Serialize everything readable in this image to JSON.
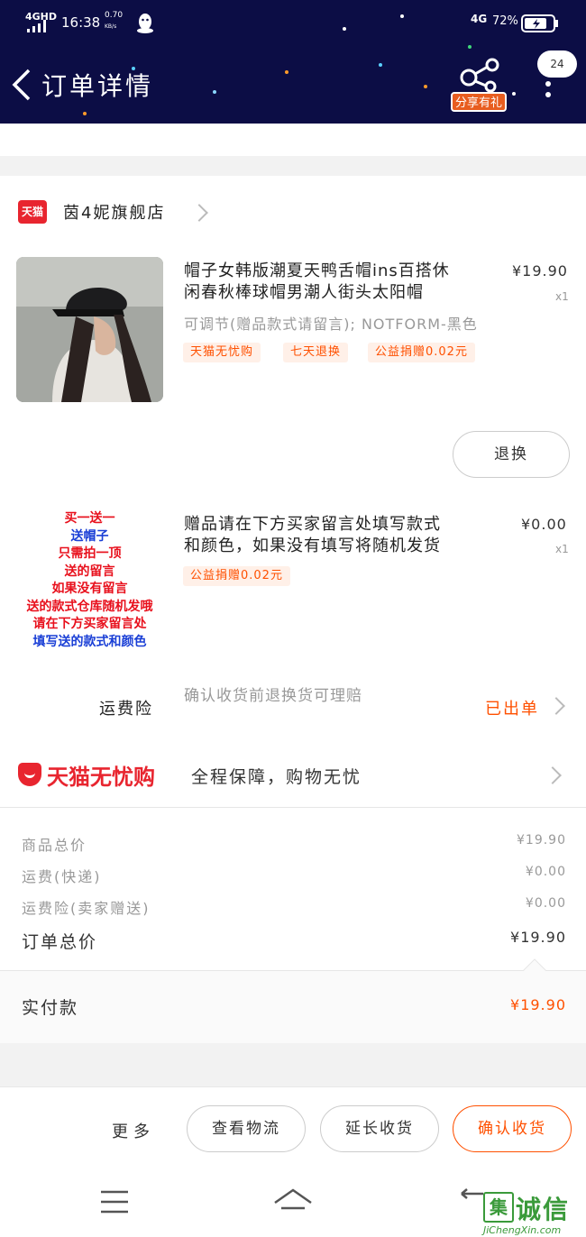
{
  "status_bar": {
    "network": "4GHD",
    "time": "16:38",
    "speed_value": "0.70",
    "speed_unit": "KB/s",
    "network_right": "4G",
    "battery": "72%"
  },
  "header": {
    "title": "订单详情",
    "share_label": "分享有礼",
    "message_count": "24"
  },
  "store": {
    "badge": "天猫",
    "name": "茵4妮旗舰店"
  },
  "items": [
    {
      "title_line1": "帽子女韩版潮夏天鸭舌帽ins百搭休",
      "title_line2": "闲春秋棒球帽男潮人街头太阳帽",
      "price": "¥19.90",
      "qty": "x1",
      "sku": "可调节(赠品款式请留言); NOTFORM-黑色",
      "tags": [
        "天猫无忧购",
        "七天退换",
        "公益捐赠0.02元"
      ],
      "action": "退换"
    },
    {
      "title_line1": "赠品请在下方买家留言处填写款式",
      "title_line2": "和颜色，如果没有填写将随机发货",
      "price": "¥0.00",
      "qty": "x1",
      "tags": [
        "公益捐赠0.02元"
      ],
      "image_text": [
        "买一送一",
        "送帽子",
        "只需拍一顶",
        "送的留言",
        "如果没有留言",
        "送的款式仓库随机发哦",
        "请在下方买家留言处",
        "填写送的款式和颜色"
      ]
    }
  ],
  "insurance": {
    "label": "运费险",
    "desc": "确认收货前退换货可理赔",
    "status": "已出单"
  },
  "wuyou": {
    "logo": "天猫无忧购",
    "desc": "全程保障，购物无忧"
  },
  "summary": {
    "rows": [
      {
        "label": "商品总价",
        "value": "¥19.90"
      },
      {
        "label": "运费(快递)",
        "value": "¥0.00"
      },
      {
        "label": "运费险(卖家赠送)",
        "value": "¥0.00"
      }
    ],
    "total_label": "订单总价",
    "total_value": "¥19.90",
    "paid_label": "实付款",
    "paid_value": "¥19.90"
  },
  "bottom_bar": {
    "more": "更多",
    "view_logistics": "查看物流",
    "extend_receipt": "延长收货",
    "confirm_receipt": "确认收货"
  },
  "watermark": {
    "brand": "诚信",
    "url": "JiChengXin.com"
  },
  "colors": {
    "header_bg": "#0c0d45",
    "accent": "#ff5000",
    "tmall_red": "#e8252f"
  }
}
